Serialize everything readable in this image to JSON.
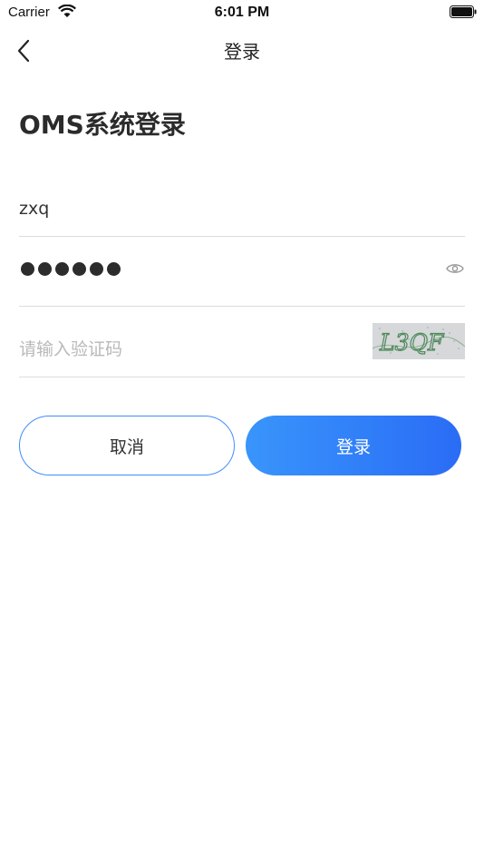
{
  "status_bar": {
    "carrier": "Carrier",
    "time": "6:01 PM"
  },
  "nav": {
    "title": "登录",
    "back_icon": "chevron-left-icon"
  },
  "page_title": "OMS系统登录",
  "form": {
    "username_value": "zxq",
    "password_dot_count": 6,
    "captcha_placeholder": "请输入验证码",
    "captcha_text": "L3QF"
  },
  "buttons": {
    "cancel_label": "取消",
    "login_label": "登录"
  },
  "colors": {
    "accent": "#3f8dfb",
    "gradient_start": "#3995fb",
    "gradient_end": "#2a6cf6"
  }
}
